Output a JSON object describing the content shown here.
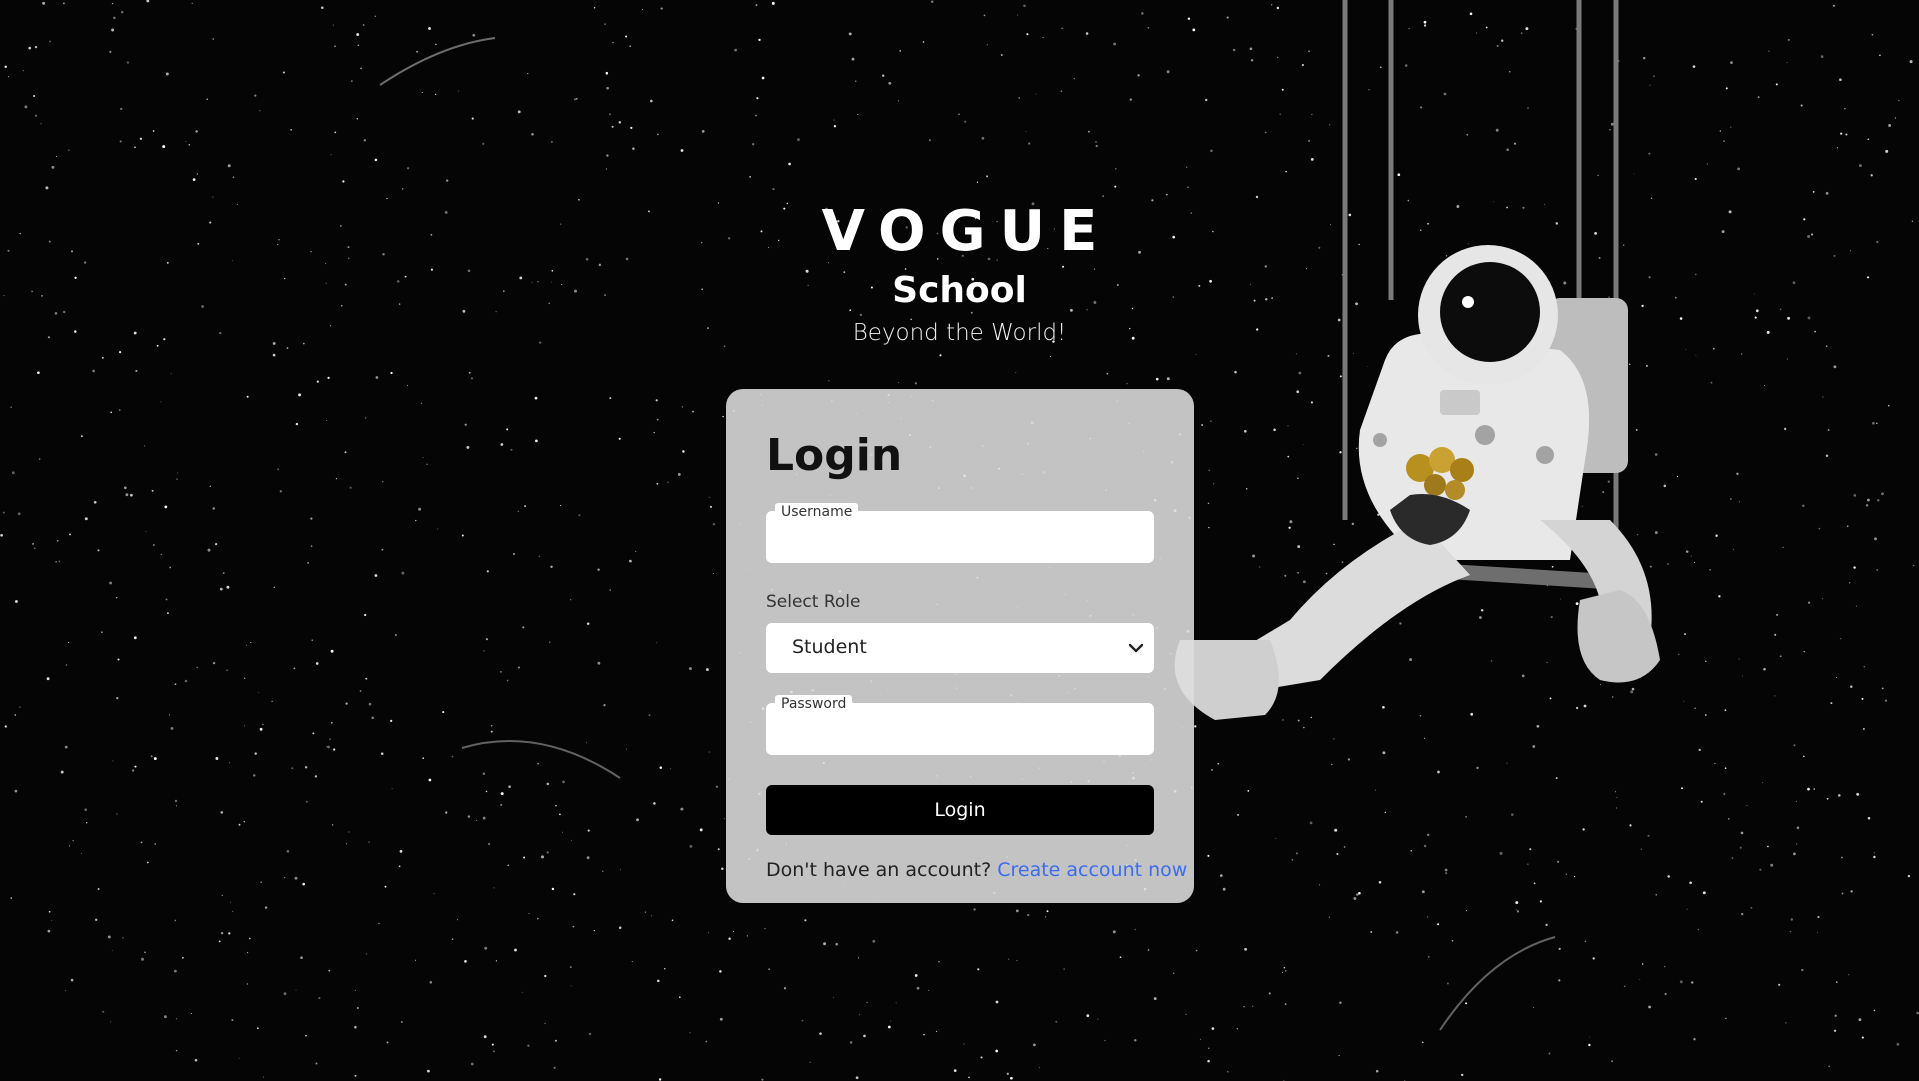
{
  "brand": {
    "title": "VOGUE",
    "subtitle": "School",
    "tagline": "Beyond the World!"
  },
  "login_form": {
    "heading": "Login",
    "username": {
      "label": "Username",
      "value": ""
    },
    "role": {
      "label": "Select Role",
      "selected": "Student"
    },
    "password": {
      "label": "Password",
      "value": ""
    },
    "submit_label": "Login",
    "signup_prompt": "Don't have an account?",
    "signup_link": "Create account now"
  },
  "colors": {
    "background": "#050505",
    "card": "#dedede",
    "button": "#000000",
    "link": "#3b6cf0"
  },
  "icons": {
    "select_arrow": "chevron-down-icon",
    "background_art": "astronaut-on-swing-illustration"
  }
}
